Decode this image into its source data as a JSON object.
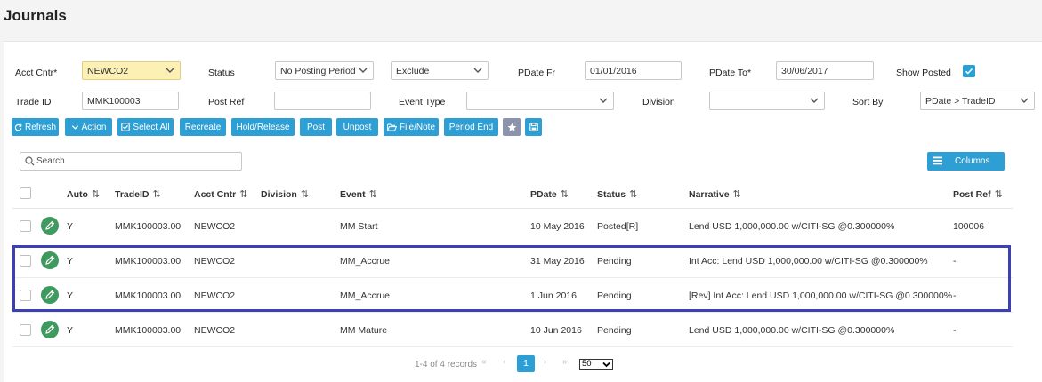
{
  "page": {
    "title": "Journals"
  },
  "filters": {
    "acct_cntr_label": "Acct Cntr*",
    "acct_cntr_value": "NEWCO2",
    "status_label": "Status",
    "status_value": "No Posting Period",
    "status2_value": "Exclude",
    "pdate_fr_label": "PDate Fr",
    "pdate_fr_value": "01/01/2016",
    "pdate_to_label": "PDate To*",
    "pdate_to_value": "30/06/2017",
    "show_posted_label": "Show Posted",
    "show_posted_checked": true,
    "trade_id_label": "Trade ID",
    "trade_id_value": "MMK100003",
    "post_ref_label": "Post Ref",
    "post_ref_value": "",
    "event_type_label": "Event Type",
    "event_type_value": "",
    "division_label": "Division",
    "division_value": "",
    "sort_by_label": "Sort By",
    "sort_by_value": "PDate > TradeID"
  },
  "toolbar": {
    "refresh": "Refresh",
    "action": "Action",
    "select_all": "Select All",
    "recreate": "Recreate",
    "hold_release": "Hold/Release",
    "post": "Post",
    "unpost": "Unpost",
    "file_note": "File/Note",
    "period_end": "Period End"
  },
  "table": {
    "search_placeholder": "Search",
    "columns_button": "Columns",
    "headers": {
      "auto": "Auto",
      "trade_id": "TradeID",
      "acct_cntr": "Acct Cntr",
      "division": "Division",
      "event": "Event",
      "pdate": "PDate",
      "status": "Status",
      "narrative": "Narrative",
      "post_ref": "Post Ref"
    },
    "sort_glyph": "⇅",
    "rows": [
      {
        "auto": "Y",
        "trade_id": "MMK100003.00",
        "acct_cntr": "NEWCO2",
        "division": "",
        "event": "MM Start",
        "pdate": "10 May 2016",
        "status": "Posted[R]",
        "narrative": "Lend USD 1,000,000.00 w/CITI-SG @0.300000%",
        "post_ref": "100006"
      },
      {
        "auto": "Y",
        "trade_id": "MMK100003.00",
        "acct_cntr": "NEWCO2",
        "division": "",
        "event": "MM_Accrue",
        "pdate": "31 May 2016",
        "status": "Pending",
        "narrative": "Int Acc: Lend USD 1,000,000.00 w/CITI-SG @0.300000%",
        "post_ref": "-"
      },
      {
        "auto": "Y",
        "trade_id": "MMK100003.00",
        "acct_cntr": "NEWCO2",
        "division": "",
        "event": "MM_Accrue",
        "pdate": "1 Jun 2016",
        "status": "Pending",
        "narrative": "[Rev] Int Acc: Lend USD 1,000,000.00 w/CITI-SG @0.300000%",
        "post_ref": "-"
      },
      {
        "auto": "Y",
        "trade_id": "MMK100003.00",
        "acct_cntr": "NEWCO2",
        "division": "",
        "event": "MM Mature",
        "pdate": "10 Jun 2016",
        "status": "Pending",
        "narrative": "Lend USD 1,000,000.00 w/CITI-SG @0.300000%",
        "post_ref": "-"
      }
    ]
  },
  "pagination": {
    "summary": "1-4 of 4 records",
    "first": "«",
    "prev": "‹",
    "current": "1",
    "next": "›",
    "last": "»",
    "page_size": "50"
  },
  "colors": {
    "accent": "#2e9fd4",
    "edit_button": "#3e9a5f",
    "highlight_border": "#3d3fb5",
    "acct_cntr_bg": "#fdf0b5"
  }
}
